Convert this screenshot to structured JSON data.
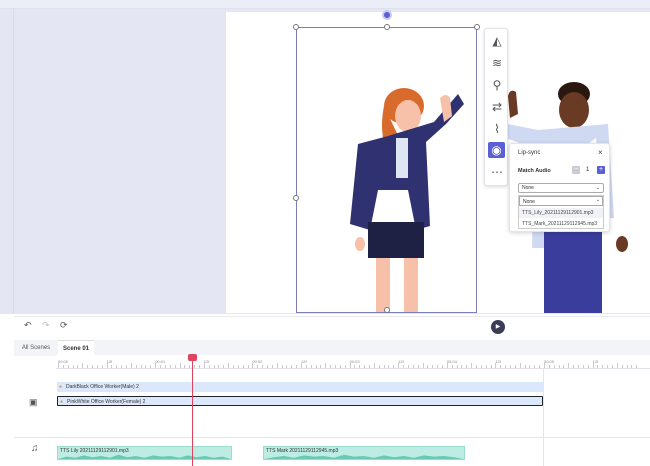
{
  "toolbar_icons": [
    "flip-icon",
    "layers-icon",
    "animation-icon",
    "swap-icon",
    "motion-path-icon",
    "lip-sync-icon",
    "more-icon"
  ],
  "lipsync": {
    "title": "Lip-sync",
    "match_audio_label": "Match Audio",
    "count": "1",
    "select_value": "None",
    "options": [
      "None",
      "TTS_Lily_20211129112901.mp3",
      "TTS_Mark_20211129112945.mp3"
    ]
  },
  "tabs": {
    "all": "All Scenes",
    "scene": "Scene 01"
  },
  "ruler": {
    "labels": [
      "00:00",
      "12f",
      "00:01",
      "12f",
      "00:02",
      "12f",
      "00:03",
      "12f",
      "00:04",
      "12f",
      "00:05",
      "12f"
    ]
  },
  "tracks": {
    "male": "DarkBlack Office Worker(Male) 2",
    "female": "PinkWhite Office Worker(Female) 2",
    "audio1": "TTS Lily 20211129112901.mp3",
    "audio2": "TTS Mark 20211129112945.mp3"
  },
  "playhead_time_fraction": 0.28,
  "colors": {
    "accent": "#5a5fd6",
    "playhead": "#e0435b",
    "clip_blue": "#dbe8fb",
    "audio_green": "#bdece3"
  }
}
